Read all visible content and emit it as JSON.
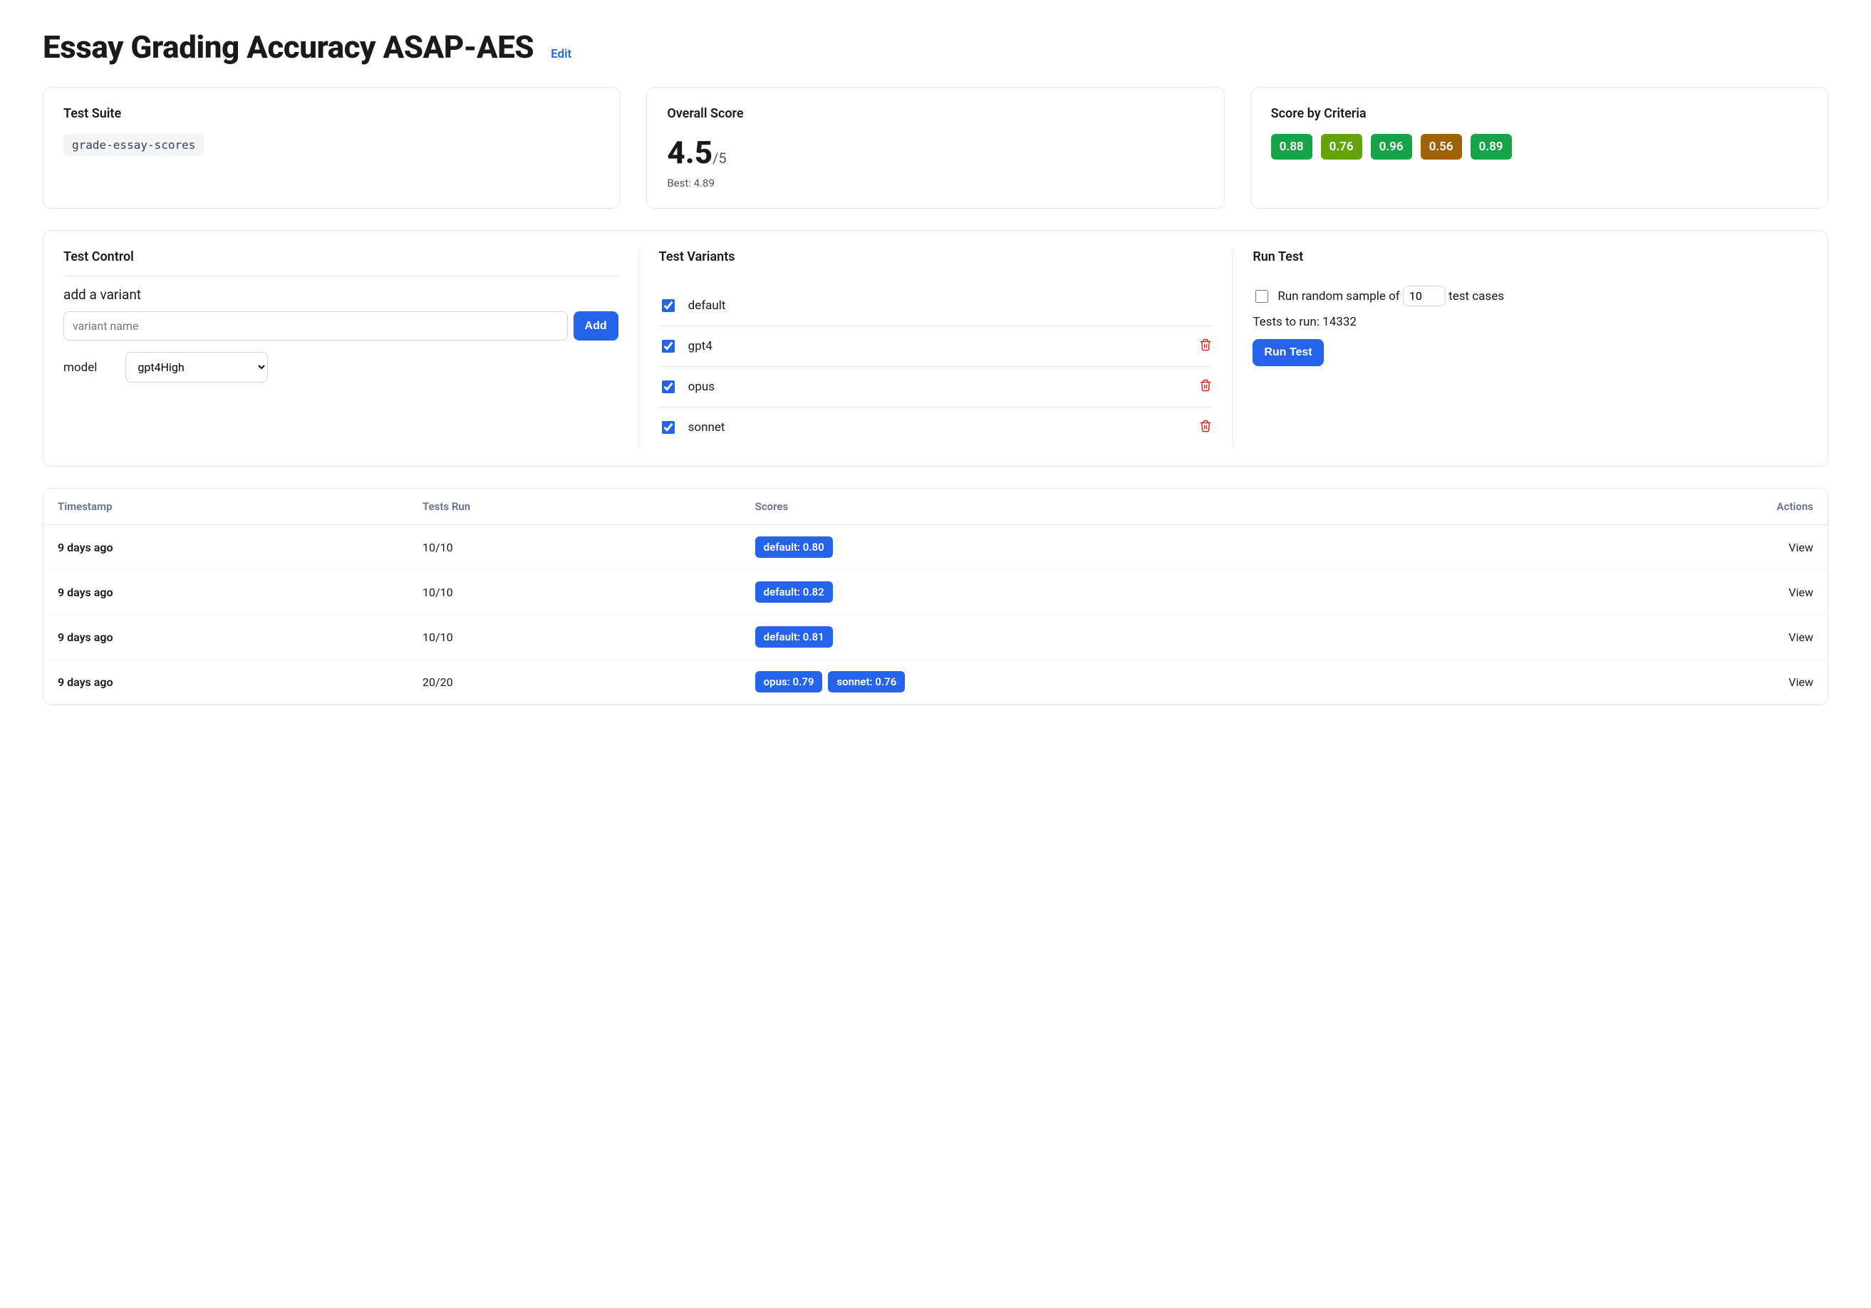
{
  "header": {
    "title": "Essay Grading Accuracy ASAP-AES",
    "edit_label": "Edit"
  },
  "test_suite": {
    "title": "Test Suite",
    "name": "grade-essay-scores"
  },
  "overall_score": {
    "title": "Overall Score",
    "value": "4.5",
    "denom": "/5",
    "best_label": "Best: 4.89"
  },
  "score_by_criteria": {
    "title": "Score by Criteria",
    "items": [
      {
        "value": "0.88",
        "color": "#16a34a"
      },
      {
        "value": "0.76",
        "color": "#65a30d"
      },
      {
        "value": "0.96",
        "color": "#16a34a"
      },
      {
        "value": "0.56",
        "color": "#a16207"
      },
      {
        "value": "0.89",
        "color": "#16a34a"
      }
    ]
  },
  "test_control": {
    "title": "Test Control",
    "add_variant_label": "add a variant",
    "variant_placeholder": "variant name",
    "add_button": "Add",
    "model_label": "model",
    "model_value": "gpt4High"
  },
  "test_variants": {
    "title": "Test Variants",
    "items": [
      {
        "name": "default",
        "checked": true,
        "deletable": false
      },
      {
        "name": "gpt4",
        "checked": true,
        "deletable": true
      },
      {
        "name": "opus",
        "checked": true,
        "deletable": true
      },
      {
        "name": "sonnet",
        "checked": true,
        "deletable": true
      }
    ]
  },
  "run_test": {
    "title": "Run Test",
    "sample_prefix": "Run random sample of",
    "sample_value": "10",
    "sample_suffix": "test cases",
    "sample_checked": false,
    "tests_to_run": "Tests to run: 14332",
    "button": "Run Test"
  },
  "runs_table": {
    "columns": {
      "timestamp": "Timestamp",
      "tests_run": "Tests Run",
      "scores": "Scores",
      "actions": "Actions"
    },
    "view_label": "View",
    "rows": [
      {
        "timestamp": "9 days ago",
        "tests_run": "10/10",
        "scores": [
          {
            "label": "default: 0.80"
          }
        ]
      },
      {
        "timestamp": "9 days ago",
        "tests_run": "10/10",
        "scores": [
          {
            "label": "default: 0.82"
          }
        ]
      },
      {
        "timestamp": "9 days ago",
        "tests_run": "10/10",
        "scores": [
          {
            "label": "default: 0.81"
          }
        ]
      },
      {
        "timestamp": "9 days ago",
        "tests_run": "20/20",
        "scores": [
          {
            "label": "opus: 0.79"
          },
          {
            "label": "sonnet: 0.76"
          }
        ]
      }
    ]
  }
}
